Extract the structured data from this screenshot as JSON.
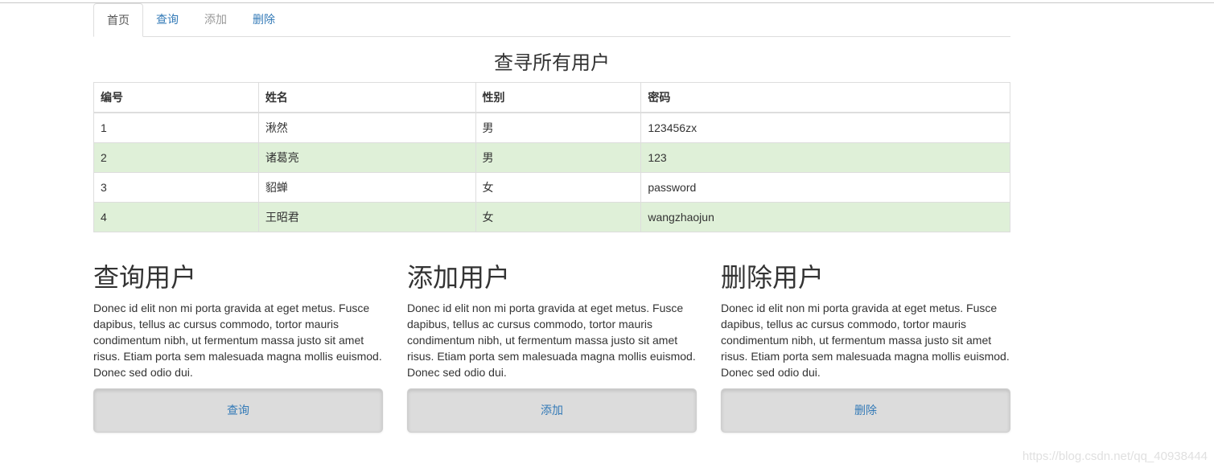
{
  "tabs": [
    {
      "label": "首页",
      "state": "active"
    },
    {
      "label": "查询",
      "state": "link"
    },
    {
      "label": "添加",
      "state": "disabled"
    },
    {
      "label": "删除",
      "state": "link"
    }
  ],
  "page_title": "查寻所有用户",
  "table": {
    "headers": [
      "编号",
      "姓名",
      "性别",
      "密码"
    ],
    "rows": [
      [
        "1",
        "湫然",
        "男",
        "123456zx"
      ],
      [
        "2",
        "诸葛亮",
        "男",
        "123"
      ],
      [
        "3",
        "貂蝉",
        "女",
        "password"
      ],
      [
        "4",
        "王昭君",
        "女",
        "wangzhaojun"
      ]
    ]
  },
  "sections": [
    {
      "title": "查询用户",
      "text": "Donec id elit non mi porta gravida at eget metus. Fusce dapibus, tellus ac cursus commodo, tortor mauris condimentum nibh, ut fermentum massa justo sit amet risus. Etiam porta sem malesuada magna mollis euismod. Donec sed odio dui.",
      "button": "查询"
    },
    {
      "title": "添加用户",
      "text": "Donec id elit non mi porta gravida at eget metus. Fusce dapibus, tellus ac cursus commodo, tortor mauris condimentum nibh, ut fermentum massa justo sit amet risus. Etiam porta sem malesuada magna mollis euismod. Donec sed odio dui.",
      "button": "添加"
    },
    {
      "title": "删除用户",
      "text": "Donec id elit non mi porta gravida at eget metus. Fusce dapibus, tellus ac cursus commodo, tortor mauris condimentum nibh, ut fermentum massa justo sit amet risus. Etiam porta sem malesuada magna mollis euismod. Donec sed odio dui.",
      "button": "删除"
    }
  ],
  "watermark": "https://blog.csdn.net/qq_40938444",
  "colors": {
    "link": "#337ab7",
    "row_success": "#dff0d8",
    "button_bg": "#dcdcdc"
  }
}
